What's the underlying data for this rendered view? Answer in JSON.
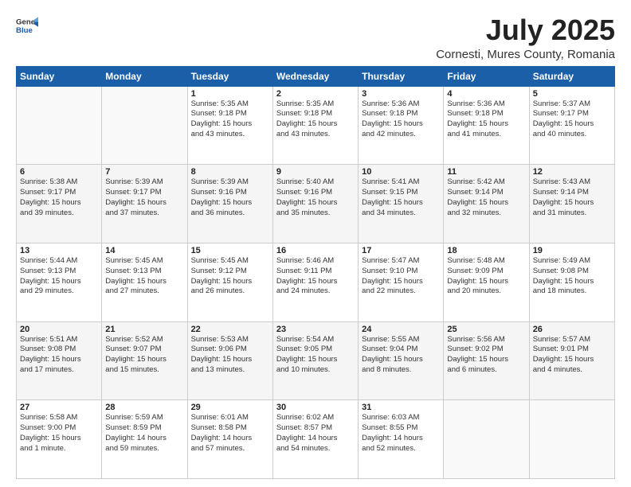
{
  "header": {
    "logo_general": "General",
    "logo_blue": "Blue",
    "month_title": "July 2025",
    "location": "Cornesti, Mures County, Romania"
  },
  "days_of_week": [
    "Sunday",
    "Monday",
    "Tuesday",
    "Wednesday",
    "Thursday",
    "Friday",
    "Saturday"
  ],
  "weeks": [
    [
      {
        "day": "",
        "info": ""
      },
      {
        "day": "",
        "info": ""
      },
      {
        "day": "1",
        "info": "Sunrise: 5:35 AM\nSunset: 9:18 PM\nDaylight: 15 hours\nand 43 minutes."
      },
      {
        "day": "2",
        "info": "Sunrise: 5:35 AM\nSunset: 9:18 PM\nDaylight: 15 hours\nand 43 minutes."
      },
      {
        "day": "3",
        "info": "Sunrise: 5:36 AM\nSunset: 9:18 PM\nDaylight: 15 hours\nand 42 minutes."
      },
      {
        "day": "4",
        "info": "Sunrise: 5:36 AM\nSunset: 9:18 PM\nDaylight: 15 hours\nand 41 minutes."
      },
      {
        "day": "5",
        "info": "Sunrise: 5:37 AM\nSunset: 9:17 PM\nDaylight: 15 hours\nand 40 minutes."
      }
    ],
    [
      {
        "day": "6",
        "info": "Sunrise: 5:38 AM\nSunset: 9:17 PM\nDaylight: 15 hours\nand 39 minutes."
      },
      {
        "day": "7",
        "info": "Sunrise: 5:39 AM\nSunset: 9:17 PM\nDaylight: 15 hours\nand 37 minutes."
      },
      {
        "day": "8",
        "info": "Sunrise: 5:39 AM\nSunset: 9:16 PM\nDaylight: 15 hours\nand 36 minutes."
      },
      {
        "day": "9",
        "info": "Sunrise: 5:40 AM\nSunset: 9:16 PM\nDaylight: 15 hours\nand 35 minutes."
      },
      {
        "day": "10",
        "info": "Sunrise: 5:41 AM\nSunset: 9:15 PM\nDaylight: 15 hours\nand 34 minutes."
      },
      {
        "day": "11",
        "info": "Sunrise: 5:42 AM\nSunset: 9:14 PM\nDaylight: 15 hours\nand 32 minutes."
      },
      {
        "day": "12",
        "info": "Sunrise: 5:43 AM\nSunset: 9:14 PM\nDaylight: 15 hours\nand 31 minutes."
      }
    ],
    [
      {
        "day": "13",
        "info": "Sunrise: 5:44 AM\nSunset: 9:13 PM\nDaylight: 15 hours\nand 29 minutes."
      },
      {
        "day": "14",
        "info": "Sunrise: 5:45 AM\nSunset: 9:13 PM\nDaylight: 15 hours\nand 27 minutes."
      },
      {
        "day": "15",
        "info": "Sunrise: 5:45 AM\nSunset: 9:12 PM\nDaylight: 15 hours\nand 26 minutes."
      },
      {
        "day": "16",
        "info": "Sunrise: 5:46 AM\nSunset: 9:11 PM\nDaylight: 15 hours\nand 24 minutes."
      },
      {
        "day": "17",
        "info": "Sunrise: 5:47 AM\nSunset: 9:10 PM\nDaylight: 15 hours\nand 22 minutes."
      },
      {
        "day": "18",
        "info": "Sunrise: 5:48 AM\nSunset: 9:09 PM\nDaylight: 15 hours\nand 20 minutes."
      },
      {
        "day": "19",
        "info": "Sunrise: 5:49 AM\nSunset: 9:08 PM\nDaylight: 15 hours\nand 18 minutes."
      }
    ],
    [
      {
        "day": "20",
        "info": "Sunrise: 5:51 AM\nSunset: 9:08 PM\nDaylight: 15 hours\nand 17 minutes."
      },
      {
        "day": "21",
        "info": "Sunrise: 5:52 AM\nSunset: 9:07 PM\nDaylight: 15 hours\nand 15 minutes."
      },
      {
        "day": "22",
        "info": "Sunrise: 5:53 AM\nSunset: 9:06 PM\nDaylight: 15 hours\nand 13 minutes."
      },
      {
        "day": "23",
        "info": "Sunrise: 5:54 AM\nSunset: 9:05 PM\nDaylight: 15 hours\nand 10 minutes."
      },
      {
        "day": "24",
        "info": "Sunrise: 5:55 AM\nSunset: 9:04 PM\nDaylight: 15 hours\nand 8 minutes."
      },
      {
        "day": "25",
        "info": "Sunrise: 5:56 AM\nSunset: 9:02 PM\nDaylight: 15 hours\nand 6 minutes."
      },
      {
        "day": "26",
        "info": "Sunrise: 5:57 AM\nSunset: 9:01 PM\nDaylight: 15 hours\nand 4 minutes."
      }
    ],
    [
      {
        "day": "27",
        "info": "Sunrise: 5:58 AM\nSunset: 9:00 PM\nDaylight: 15 hours\nand 1 minute."
      },
      {
        "day": "28",
        "info": "Sunrise: 5:59 AM\nSunset: 8:59 PM\nDaylight: 14 hours\nand 59 minutes."
      },
      {
        "day": "29",
        "info": "Sunrise: 6:01 AM\nSunset: 8:58 PM\nDaylight: 14 hours\nand 57 minutes."
      },
      {
        "day": "30",
        "info": "Sunrise: 6:02 AM\nSunset: 8:57 PM\nDaylight: 14 hours\nand 54 minutes."
      },
      {
        "day": "31",
        "info": "Sunrise: 6:03 AM\nSunset: 8:55 PM\nDaylight: 14 hours\nand 52 minutes."
      },
      {
        "day": "",
        "info": ""
      },
      {
        "day": "",
        "info": ""
      }
    ]
  ]
}
